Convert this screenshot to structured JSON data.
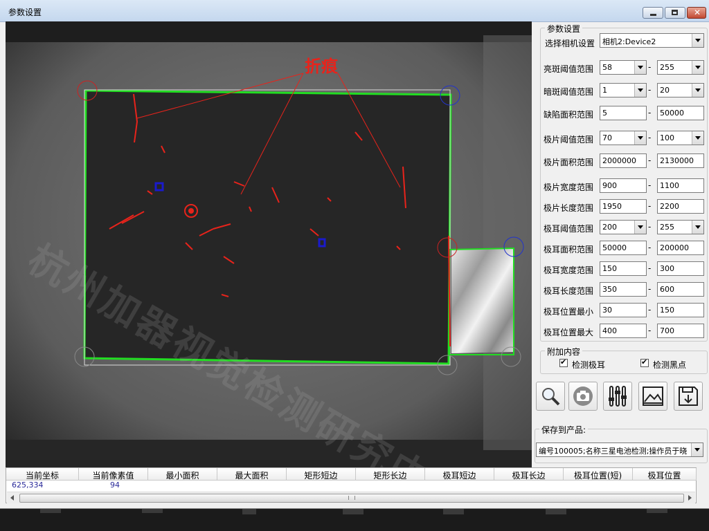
{
  "window": {
    "title": "参数设置"
  },
  "image": {
    "annotation_label": "折痕",
    "watermark": "杭州加器视觉检测研究中心"
  },
  "params": {
    "group_title": "参数设置",
    "camera_label": "选择相机设置",
    "camera_value": "相机2:Device2",
    "rows": [
      {
        "label": "亮斑阈值范围",
        "min": "58",
        "max": "255",
        "min_dropdown": true,
        "max_dropdown": true
      },
      {
        "label": "暗斑阈值范围",
        "min": "1",
        "max": "20",
        "min_dropdown": true,
        "max_dropdown": true
      },
      {
        "label": "缺陷面积范围",
        "min": "5",
        "max": "50000",
        "min_dropdown": false,
        "max_dropdown": false
      },
      {
        "label": "极片阈值范围",
        "min": "70",
        "max": "100",
        "min_dropdown": true,
        "max_dropdown": true
      },
      {
        "label": "极片面积范围",
        "min": "2000000",
        "max": "2130000",
        "min_dropdown": false,
        "max_dropdown": false
      },
      {
        "label": "极片宽度范围",
        "min": "900",
        "max": "1100",
        "min_dropdown": false,
        "max_dropdown": false
      },
      {
        "label": "极片长度范围",
        "min": "1950",
        "max": "2200",
        "min_dropdown": false,
        "max_dropdown": false
      },
      {
        "label": "极耳阈值范围",
        "min": "200",
        "max": "255",
        "min_dropdown": true,
        "max_dropdown": true
      },
      {
        "label": "极耳面积范围",
        "min": "50000",
        "max": "200000",
        "min_dropdown": false,
        "max_dropdown": false
      },
      {
        "label": "极耳宽度范围",
        "min": "150",
        "max": "300",
        "min_dropdown": false,
        "max_dropdown": false
      },
      {
        "label": "极耳长度范围",
        "min": "350",
        "max": "600",
        "min_dropdown": false,
        "max_dropdown": false
      },
      {
        "label": "极耳位置最小",
        "min": "30",
        "max": "150",
        "min_dropdown": false,
        "max_dropdown": false
      },
      {
        "label": "极耳位置最大",
        "min": "400",
        "max": "700",
        "min_dropdown": false,
        "max_dropdown": false
      }
    ],
    "range_separator": "-"
  },
  "extra": {
    "group_title": "附加内容",
    "checkbox1": "检测极耳",
    "checkbox2": "检测黑点",
    "checkbox1_checked": true,
    "checkbox2_checked": true
  },
  "toolbar": {
    "buttons": [
      "search-icon",
      "camera-icon",
      "sliders-icon",
      "image-icon",
      "save-icon"
    ]
  },
  "save": {
    "group_title": "保存到产品:",
    "product_value": "编号100005;名称三星电池检测;操作员于晓"
  },
  "table": {
    "headers": [
      "当前坐标",
      "当前像素值",
      "最小面积",
      "最大面积",
      "矩形短边",
      "矩形长边",
      "极耳短边",
      "极耳长边",
      "极耳位置(短)",
      "极耳位置"
    ],
    "values": [
      "625,334",
      "94",
      "",
      "",
      "",
      "",
      "",
      "",
      "",
      ""
    ]
  },
  "colors": {
    "defect_red": "#e8231b",
    "contour_green": "#22dd22",
    "mark_blue": "#1a1acc"
  }
}
